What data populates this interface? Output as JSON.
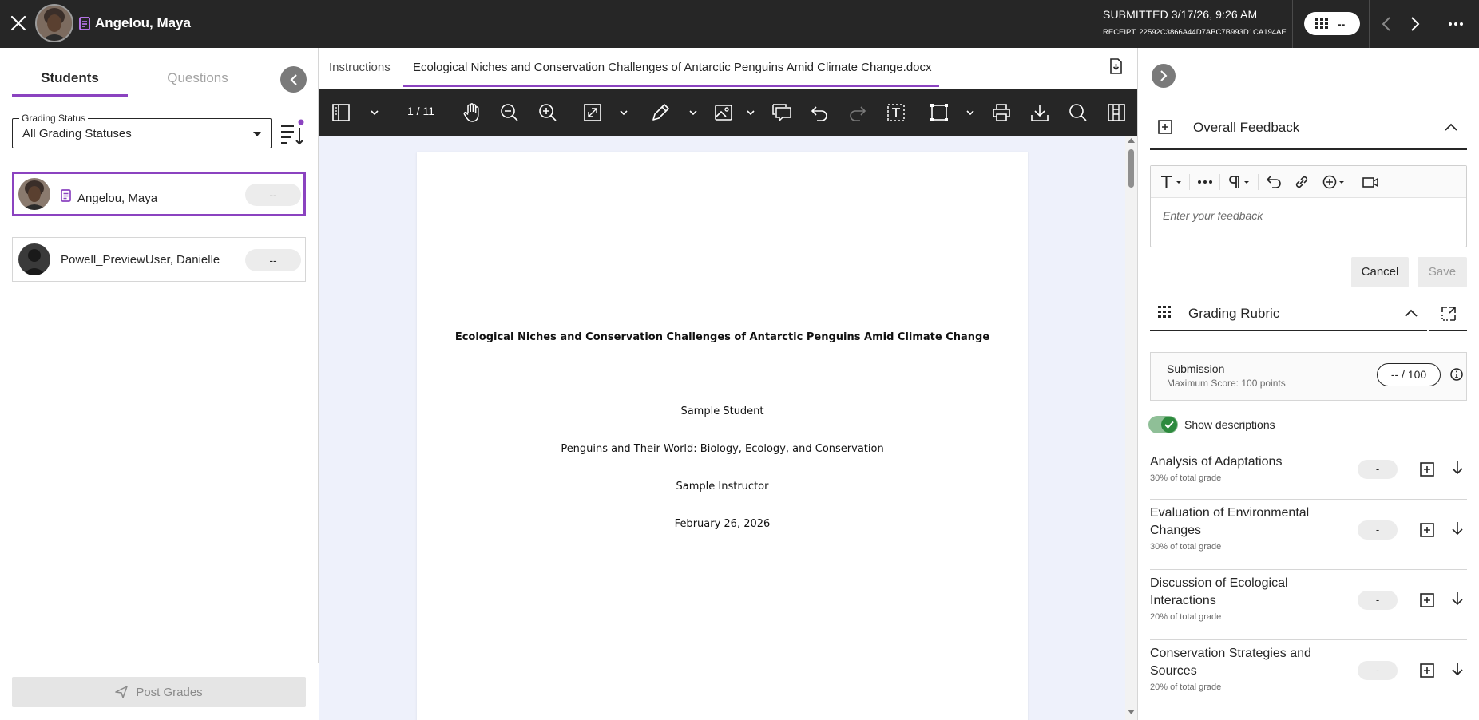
{
  "topbar": {
    "student_name": "Angelou, Maya",
    "submitted": "SUBMITTED 3/17/26, 9:26 AM",
    "receipt": "RECEIPT: 22592C3866A44D7ABC7B993D1CA194AE",
    "grade_pill": "--"
  },
  "left": {
    "tabs": {
      "students": "Students",
      "questions": "Questions"
    },
    "grading_status": {
      "label": "Grading Status",
      "value": "All Grading Statuses"
    },
    "students": [
      {
        "name": "Angelou, Maya",
        "grade": "--",
        "selected": true
      },
      {
        "name": "Powell_PreviewUser, Danielle",
        "grade": "--",
        "selected": false
      }
    ],
    "post_grades": "Post Grades"
  },
  "center": {
    "tabs": {
      "instructions": "Instructions",
      "document": "Ecological Niches and Conservation Challenges of Antarctic Penguins Amid Climate Change.docx"
    },
    "page_indicator": "1 / 11",
    "document": {
      "title": "Ecological Niches and Conservation Challenges of Antarctic Penguins Amid Climate Change",
      "author": "Sample Student",
      "course": "Penguins and Their World: Biology, Ecology, and Conservation",
      "instructor": "Sample Instructor",
      "date": "February 26, 2026"
    }
  },
  "right": {
    "overall_feedback": {
      "title": "Overall Feedback",
      "placeholder": "Enter your feedback",
      "cancel": "Cancel",
      "save": "Save"
    },
    "grading_rubric": {
      "title": "Grading Rubric",
      "submission_title": "Submission",
      "max_score": "Maximum Score: 100 points",
      "score": "-- / 100",
      "show_descriptions": "Show descriptions",
      "show_descriptions_on": true,
      "criteria": [
        {
          "name": "Analysis of Adaptations",
          "pct": "30% of total grade",
          "score": "-"
        },
        {
          "name": "Evaluation of Environmental Changes",
          "pct": "30% of total grade",
          "score": "-"
        },
        {
          "name": "Discussion of Ecological Interactions",
          "pct": "20% of total grade",
          "score": "-"
        },
        {
          "name": "Conservation Strategies and Sources",
          "pct": "20% of total grade",
          "score": "-"
        }
      ]
    }
  },
  "colors": {
    "accent_purple": "#8b43c0",
    "topbar": "#262626",
    "toggle_green": "#2d8a3e"
  }
}
